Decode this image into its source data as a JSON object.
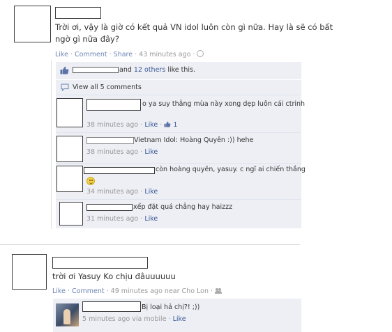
{
  "post1": {
    "text_line1": "Trời ơi, vậy là giờ có kết quả VN idol luôn còn gì nữa. Hay là sẽ có bất",
    "text_line2": "ngờ gì nữa đây?",
    "actions": {
      "like": "Like",
      "comment": "Comment",
      "share": "Share",
      "time": "43 minutes ago"
    },
    "likes": {
      "trailing": "and",
      "others": "12 others",
      "suffix": "like this."
    },
    "view_all": "View all 5 comments",
    "comments": [
      {
        "text": "o ya suy thẳng mùa này xong dẹp luôn cái ctrinh",
        "time": "38 minutes ago",
        "like": "Like",
        "like_count": "1"
      },
      {
        "text": "Vietnam Idol: Hoàng Quyên :)) hehe",
        "time": "38 minutes ago",
        "like": "Like"
      },
      {
        "text": "còn hoàng quyên, yasuy. c ngĩ ai chiến thắng",
        "time": "34 minutes ago",
        "like": "Like"
      },
      {
        "text": "xếp đặt quá chẳng hay haizzz",
        "time": "31 minutes ago",
        "like": "Like"
      }
    ]
  },
  "post2": {
    "text": "trời ơi Yasuy Ko chịu đâuuuuuu",
    "actions": {
      "like": "Like",
      "comment": "Comment",
      "time": "49 minutes ago near Cho Lon"
    },
    "comments": [
      {
        "text": "Bị loại hả chị?! ;))",
        "time": "5 minutes ago via mobile",
        "like": "Like"
      }
    ]
  },
  "colors": {
    "link": "#3b5998",
    "meta": "#999999",
    "ufi_bg": "#edeff4",
    "avatar_border": "#3b3b3b"
  }
}
